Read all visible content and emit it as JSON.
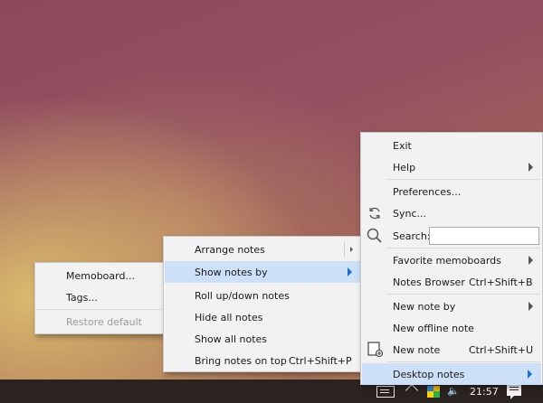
{
  "taskbar": {
    "time": "21:57"
  },
  "memoboard_menu": {
    "items": [
      {
        "label": "Memoboard..."
      },
      {
        "label": "Tags..."
      },
      {
        "label": "Restore default"
      }
    ]
  },
  "desktop_notes_menu": {
    "items": [
      {
        "label": "Arrange notes"
      },
      {
        "label": "Show notes by"
      },
      {
        "label": "Roll up/down notes"
      },
      {
        "label": "Hide all notes"
      },
      {
        "label": "Show all notes"
      },
      {
        "label": "Bring notes on top",
        "shortcut": "Ctrl+Shift+P"
      }
    ]
  },
  "main_menu": {
    "items": [
      {
        "label": "Exit"
      },
      {
        "label": "Help"
      },
      {
        "label": "Preferences..."
      },
      {
        "label": "Sync..."
      },
      {
        "label": "Search:"
      },
      {
        "label": "Favorite memoboards"
      },
      {
        "label": "Notes Browser",
        "shortcut": "Ctrl+Shift+B"
      },
      {
        "label": "New note by"
      },
      {
        "label": "New offline note"
      },
      {
        "label": "New note",
        "shortcut": "Ctrl+Shift+U"
      },
      {
        "label": "Desktop notes"
      }
    ],
    "search_value": ""
  },
  "colors": {
    "highlight": "#cce0f7",
    "arrow_active": "#1b6fd6"
  }
}
